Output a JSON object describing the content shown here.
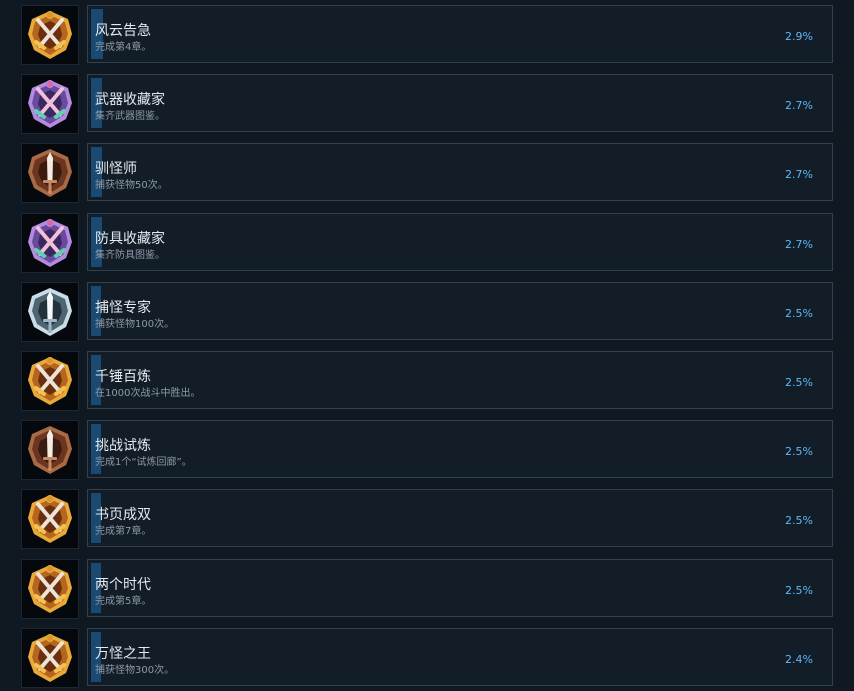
{
  "achievements": [
    {
      "title": "风云告急",
      "desc": "完成第4章。",
      "percent": "2.9%",
      "percent_value": 2.9,
      "icon": "gold-crossed-swords-badge-icon",
      "style": "gold-swords"
    },
    {
      "title": "武器收藏家",
      "desc": "集齐武器图鉴。",
      "percent": "2.7%",
      "percent_value": 2.7,
      "icon": "purple-crossed-swords-badge-icon",
      "style": "purple-swords"
    },
    {
      "title": "驯怪师",
      "desc": "捕获怪物50次。",
      "percent": "2.7%",
      "percent_value": 2.7,
      "icon": "bronze-sword-badge-icon",
      "style": "bronze-sword"
    },
    {
      "title": "防具收藏家",
      "desc": "集齐防具图鉴。",
      "percent": "2.7%",
      "percent_value": 2.7,
      "icon": "purple-crossed-swords-badge-icon",
      "style": "purple-swords"
    },
    {
      "title": "捕怪专家",
      "desc": "捕获怪物100次。",
      "percent": "2.5%",
      "percent_value": 2.5,
      "icon": "silver-sword-badge-icon",
      "style": "silver-sword"
    },
    {
      "title": "千锤百炼",
      "desc": "在1000次战斗中胜出。",
      "percent": "2.5%",
      "percent_value": 2.5,
      "icon": "gold-crossed-swords-badge-icon",
      "style": "gold-swords"
    },
    {
      "title": "挑战试炼",
      "desc": "完成1个“试炼回廊”。",
      "percent": "2.5%",
      "percent_value": 2.5,
      "icon": "bronze-sword-badge-icon",
      "style": "bronze-sword"
    },
    {
      "title": "书页成双",
      "desc": "完成第7章。",
      "percent": "2.5%",
      "percent_value": 2.5,
      "icon": "gold-crossed-swords-badge-icon",
      "style": "gold-swords"
    },
    {
      "title": "两个时代",
      "desc": "完成第5章。",
      "percent": "2.5%",
      "percent_value": 2.5,
      "icon": "gold-crossed-swords-badge-icon",
      "style": "gold-swords"
    },
    {
      "title": "万怪之王",
      "desc": "捕获怪物300次。",
      "percent": "2.4%",
      "percent_value": 2.4,
      "icon": "gold-crossed-swords-badge-icon",
      "style": "gold-swords"
    }
  ],
  "colors": {
    "background": "#101822",
    "panel": "#131d28",
    "panel_border": "#2e4153",
    "progress_fill": "#1a4a72",
    "percent_text": "#5fb7f5",
    "gold": "#d9962b",
    "purple": "#8a5fc8",
    "bronze": "#8a4a2a",
    "silver": "#9db8c6"
  }
}
